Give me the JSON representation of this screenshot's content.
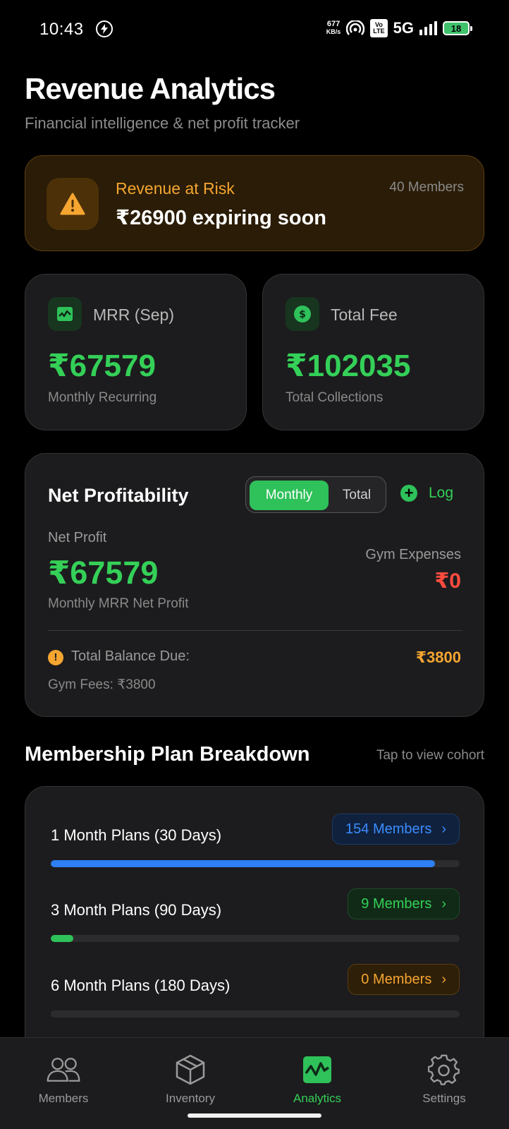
{
  "status_bar": {
    "time": "10:43",
    "speed_value": "677",
    "speed_unit": "KB/s",
    "volte_top": "Vo",
    "volte_bottom": "LTE",
    "network": "5G",
    "battery": "18"
  },
  "header": {
    "title": "Revenue Analytics",
    "subtitle": "Financial intelligence & net profit tracker"
  },
  "risk": {
    "label": "Revenue at Risk",
    "value": "₹26900 expiring soon",
    "members": "40 Members",
    "icon": "warning-icon"
  },
  "stats": [
    {
      "name": "MRR (Sep)",
      "amount": "₹67579",
      "desc": "Monthly Recurring",
      "icon": "activity-chart-icon"
    },
    {
      "name": "Total Fee",
      "amount": "₹102035",
      "desc": "Total Collections",
      "icon": "dollar-icon"
    }
  ],
  "net_profit": {
    "title": "Net Profitability",
    "toggle": {
      "active": "Monthly",
      "inactive": "Total"
    },
    "log_label": "Log",
    "profit_label": "Net Profit",
    "profit_value": "₹67579",
    "profit_desc": "Monthly MRR Net Profit",
    "expenses_label": "Gym Expenses",
    "expenses_value": "₹0",
    "balance_label": "Total Balance Due:",
    "balance_value": "₹3800",
    "fees_label": "Gym Fees: ₹3800"
  },
  "plans_section": {
    "title": "Membership Plan Breakdown",
    "hint": "Tap to view cohort",
    "plans": [
      {
        "name": "1 Month Plans (30 Days)",
        "members": "154 Members",
        "share": 0.94,
        "color": "#2f7ff5"
      },
      {
        "name": "3 Month Plans (90 Days)",
        "members": "9 Members",
        "share": 0.055,
        "color": "#2fc15a"
      },
      {
        "name": "6 Month Plans (180 Days)",
        "members": "0 Members",
        "share": 0,
        "color": "#f5a530"
      }
    ]
  },
  "nav": {
    "items": [
      {
        "label": "Members",
        "icon": "members-icon"
      },
      {
        "label": "Inventory",
        "icon": "box-icon"
      },
      {
        "label": "Analytics",
        "icon": "analytics-icon"
      },
      {
        "label": "Settings",
        "icon": "gear-icon"
      }
    ],
    "active": "Analytics"
  },
  "colors": {
    "accent_green": "#34d058",
    "warning_orange": "#f5a530",
    "danger_red": "#ff4b3e",
    "info_blue": "#3b8cff"
  }
}
